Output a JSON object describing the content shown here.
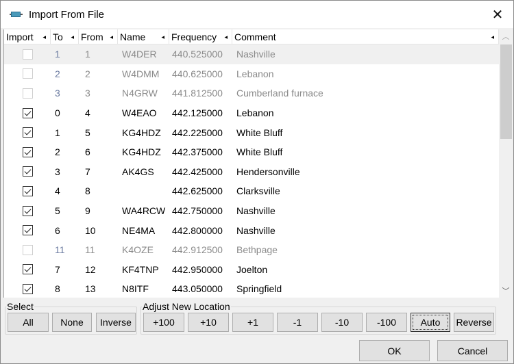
{
  "window": {
    "title": "Import From File",
    "icon": "serial-port-icon",
    "close_glyph": "✕"
  },
  "grid": {
    "columns": [
      {
        "key": "import",
        "label": "Import",
        "sort_glyph": "◂"
      },
      {
        "key": "to",
        "label": "To",
        "sort_glyph": "◂"
      },
      {
        "key": "from",
        "label": "From",
        "sort_glyph": "◂"
      },
      {
        "key": "name",
        "label": "Name",
        "sort_glyph": "◂"
      },
      {
        "key": "frequency",
        "label": "Frequency",
        "sort_glyph": "◂"
      },
      {
        "key": "comment",
        "label": "Comment",
        "sort_glyph": "◂"
      }
    ],
    "rows": [
      {
        "import": false,
        "to": "1",
        "from": "1",
        "name": "W4DER",
        "frequency": "440.525000",
        "comment": "Nashville",
        "selected": true
      },
      {
        "import": false,
        "to": "2",
        "from": "2",
        "name": "W4DMM",
        "frequency": "440.625000",
        "comment": "Lebanon"
      },
      {
        "import": false,
        "to": "3",
        "from": "3",
        "name": "N4GRW",
        "frequency": "441.812500",
        "comment": "Cumberland furnace"
      },
      {
        "import": true,
        "to": "0",
        "from": "4",
        "name": "W4EAO",
        "frequency": "442.125000",
        "comment": "Lebanon"
      },
      {
        "import": true,
        "to": "1",
        "from": "5",
        "name": "KG4HDZ",
        "frequency": "442.225000",
        "comment": "White Bluff"
      },
      {
        "import": true,
        "to": "2",
        "from": "6",
        "name": "KG4HDZ",
        "frequency": "442.375000",
        "comment": "White Bluff"
      },
      {
        "import": true,
        "to": "3",
        "from": "7",
        "name": "AK4GS",
        "frequency": "442.425000",
        "comment": "Hendersonville"
      },
      {
        "import": true,
        "to": "4",
        "from": "8",
        "name": "",
        "frequency": "442.625000",
        "comment": "Clarksville"
      },
      {
        "import": true,
        "to": "5",
        "from": "9",
        "name": "WA4RCW",
        "frequency": "442.750000",
        "comment": "Nashville"
      },
      {
        "import": true,
        "to": "6",
        "from": "10",
        "name": "NE4MA",
        "frequency": "442.800000",
        "comment": "Nashville"
      },
      {
        "import": false,
        "to": "11",
        "from": "11",
        "name": "K4OZE",
        "frequency": "442.912500",
        "comment": "Bethpage"
      },
      {
        "import": true,
        "to": "7",
        "from": "12",
        "name": "KF4TNP",
        "frequency": "442.950000",
        "comment": "Joelton"
      },
      {
        "import": true,
        "to": "8",
        "from": "13",
        "name": "N8ITF",
        "frequency": "443.050000",
        "comment": "Springfield"
      }
    ],
    "scrollbar": {
      "up_glyph": "︿",
      "down_glyph": "﹀"
    }
  },
  "select_group": {
    "label": "Select",
    "buttons": [
      "All",
      "None",
      "Inverse"
    ]
  },
  "adjust_group": {
    "label": "Adjust New Location",
    "buttons": [
      "+100",
      "+10",
      "+1",
      "-1",
      "-10",
      "-100",
      "Auto",
      "Reverse"
    ],
    "focused": "Auto"
  },
  "dialog_buttons": {
    "ok": "OK",
    "cancel": "Cancel"
  }
}
